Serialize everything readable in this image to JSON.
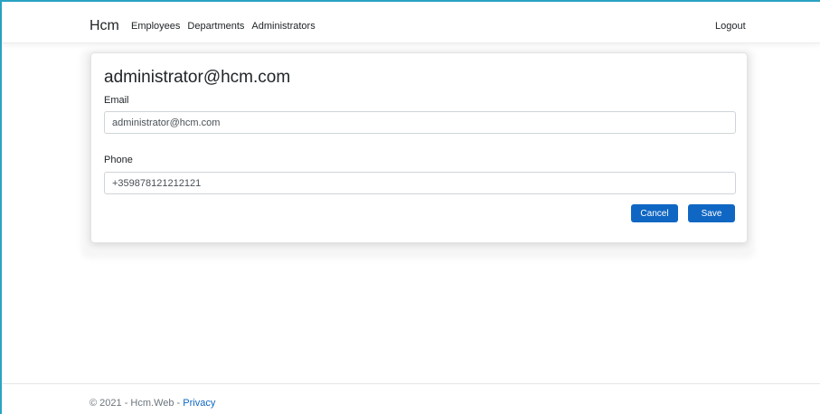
{
  "navbar": {
    "brand": "Hcm",
    "links": [
      "Employees",
      "Departments",
      "Administrators"
    ],
    "logout": "Logout"
  },
  "card": {
    "title": "administrator@hcm.com",
    "email_label": "Email",
    "email_value": "administrator@hcm.com",
    "phone_label": "Phone",
    "phone_value": "+359878121212121",
    "cancel_label": "Cancel",
    "save_label": "Save"
  },
  "footer": {
    "copyright": "© 2021 - Hcm.Web - ",
    "privacy_link": "Privacy"
  },
  "colors": {
    "accent": "#1067c3",
    "frame": "#2aa3c4"
  }
}
